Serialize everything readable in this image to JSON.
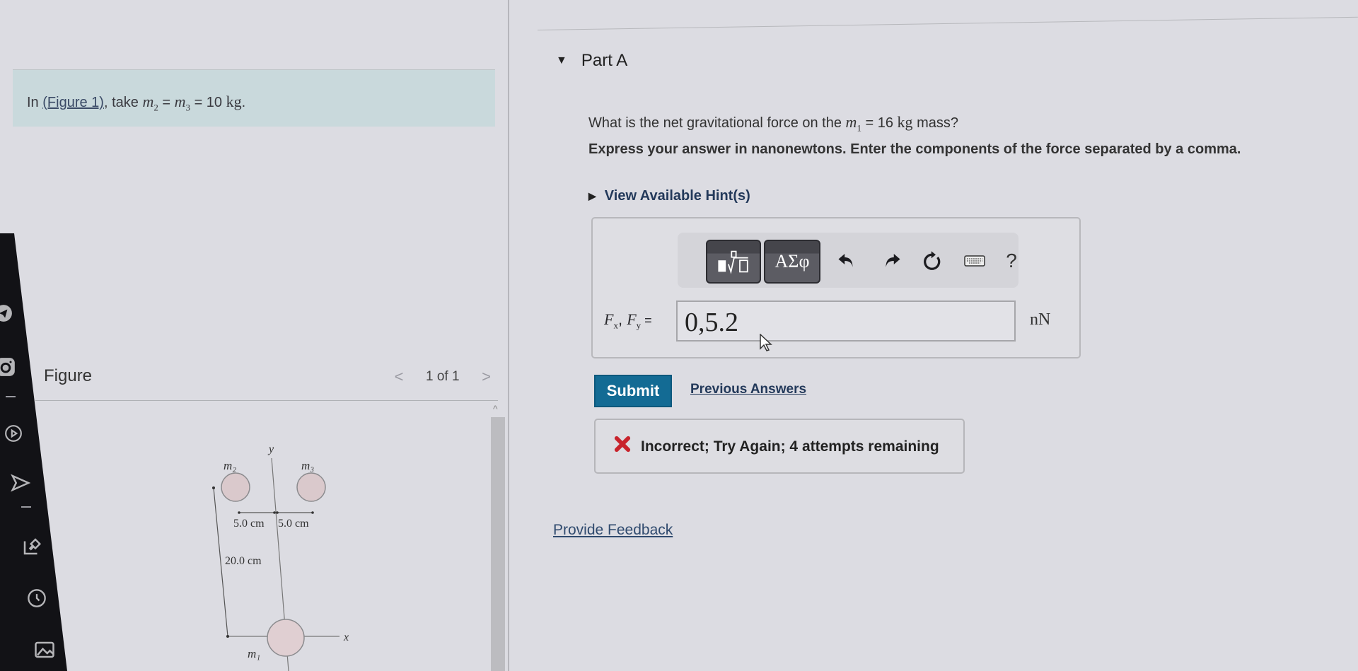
{
  "sidebar": {
    "icons": [
      "circle-icon",
      "telegram-icon",
      "instagram-icon",
      "play-icon",
      "send-icon",
      "pin-edit-icon",
      "clock-icon",
      "gallery-icon"
    ]
  },
  "intro": {
    "prefix": "In ",
    "figure_link": "(Figure 1)",
    "middle": ", take ",
    "m2": "m",
    "m2_sub": "2",
    "eq1": " = ",
    "m3": "m",
    "m3_sub": "3",
    "eq2": " = 10 ",
    "unit": "kg",
    "suffix": "."
  },
  "figure": {
    "title": "Figure",
    "pager": "1 of 1",
    "prev_label": "<",
    "next_label": ">",
    "labels": {
      "m1": "m₁",
      "m2": "m₂",
      "m3": "m₃",
      "y_axis": "y",
      "x_axis": "x",
      "dist_left": "5.0 cm",
      "dist_right": "5.0 cm",
      "dist_vertical": "20.0 cm"
    }
  },
  "part": {
    "title": "Part A",
    "question_prefix": "What is the net gravitational force on the ",
    "question_var": "m",
    "question_sub": "1",
    "question_eq": " = 16 ",
    "question_unit": "kg",
    "question_suffix": " mass?",
    "instruction": "Express your answer in nanonewtons. Enter the components of the force separated by a comma.",
    "hint_label": "View Available Hint(s)"
  },
  "answer": {
    "toolbar": {
      "templates_label": "templates",
      "symbols_label": "ΑΣφ",
      "help_label": "?"
    },
    "label_fx": "F",
    "label_fx_sub": "x",
    "label_sep": ", ",
    "label_fy": "F",
    "label_fy_sub": "y",
    "label_eq": " =",
    "input_value": "0,5.2",
    "unit": "nN"
  },
  "actions": {
    "submit": "Submit",
    "previous_answers": "Previous Answers"
  },
  "feedback": {
    "status": "Incorrect; Try Again; 4 attempts remaining",
    "color": "#c8232c"
  },
  "footer": {
    "provide_feedback": "Provide Feedback"
  }
}
